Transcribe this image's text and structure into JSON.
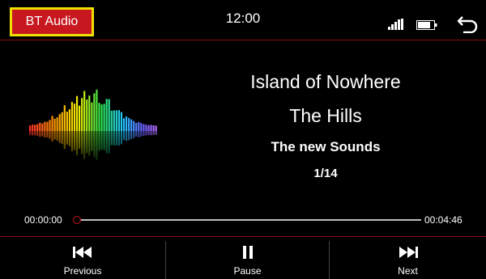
{
  "header": {
    "source_label": "BT Audio",
    "clock": "12:00",
    "icons": [
      "signal-bars-icon",
      "battery-icon",
      "back-arrow-icon"
    ],
    "accent_color": "#c8181f",
    "highlight_color": "#f0e000"
  },
  "track": {
    "title": "Island of Nowhere",
    "artist": "The Hills",
    "album": "The new Sounds",
    "index": "1/14"
  },
  "progress": {
    "elapsed": "00:00:00",
    "total": "00:04:46",
    "fraction": 0.0
  },
  "controls": {
    "previous_label": "Previous",
    "pause_label": "Pause",
    "next_label": "Next"
  }
}
